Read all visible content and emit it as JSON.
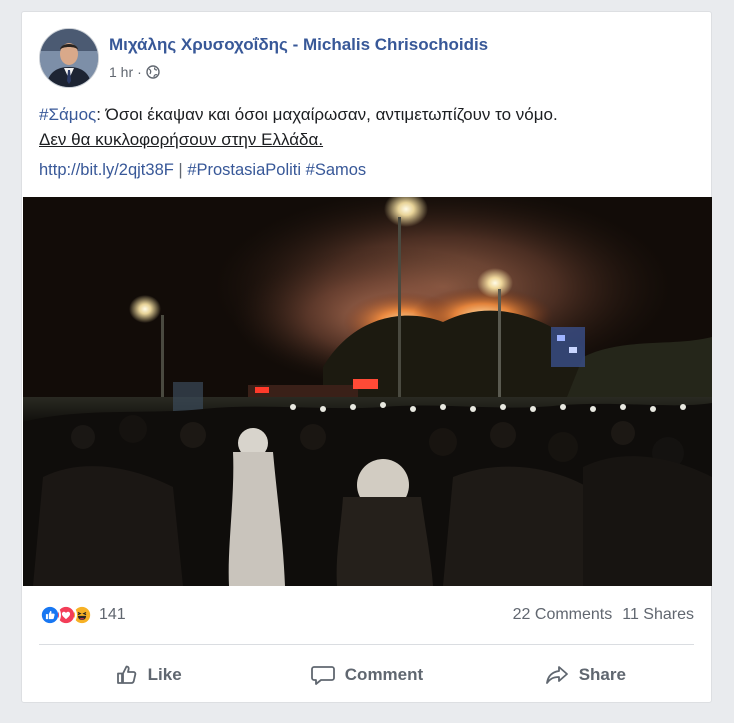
{
  "post": {
    "author": "Μιχάλης Χρυσοχοΐδης - Michalis Chrisochoidis",
    "time": "1 hr",
    "time_separator": "·",
    "privacy_icon": "globe-icon",
    "text": {
      "hashtag": "#Σάμος",
      "line1_rest": ": Όσοι έκαψαν και όσοι μαχαίρωσαν, αντιμετωπίζουν το νόμο.",
      "line2": "Δεν θα κυκλοφορήσουν στην Ελλάδα.",
      "link": "http://bit.ly/2qjt38F",
      "separator": "|",
      "hashtag2": "#ProstasiaPoliti",
      "hashtag3": "#Samos"
    }
  },
  "photo": {
    "subject": "night fire with crowd and police"
  },
  "reactions": {
    "icons": [
      "like-reaction-icon",
      "love-reaction-icon",
      "haha-reaction-icon"
    ],
    "count": "141",
    "comments": "22 Comments",
    "shares": "11 Shares"
  },
  "actions": {
    "like": "Like",
    "comment": "Comment",
    "share": "Share"
  },
  "colors": {
    "link": "#385898",
    "like_blue": "#1877f2",
    "love_red": "#f33e58",
    "haha_yellow": "#f7b125"
  }
}
